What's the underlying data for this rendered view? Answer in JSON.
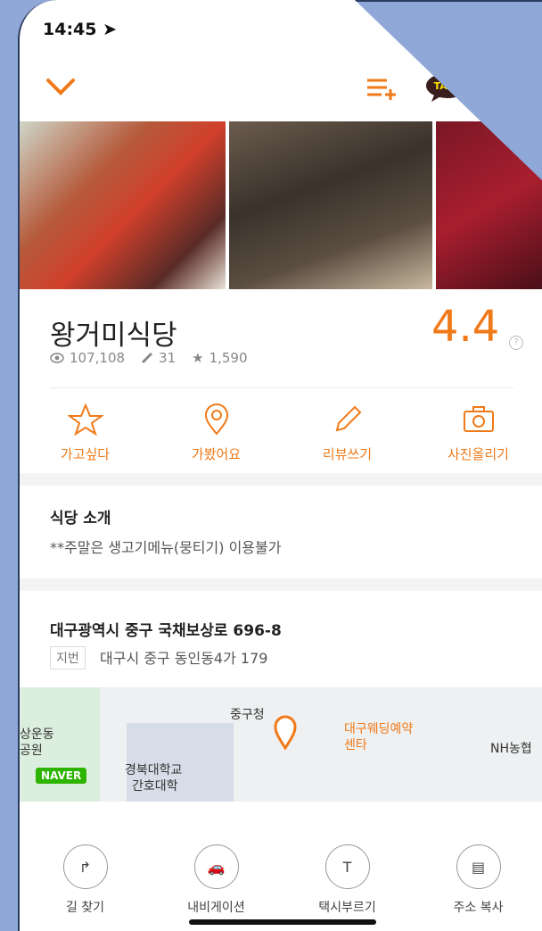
{
  "status_bar": {
    "time": "14:45 ➤"
  },
  "topbar": {
    "chevron_icon": "chevron-down-icon",
    "list_add_icon": "list-add-icon",
    "talk_badge": "TALK"
  },
  "restaurant": {
    "name": "왕거미식당",
    "views": "107,108",
    "reviews": "31",
    "stars": "1,590",
    "rating": "4.4"
  },
  "actions": [
    {
      "label": "가고싶다",
      "icon": "star-outline-icon"
    },
    {
      "label": "가봤어요",
      "icon": "location-pin-icon"
    },
    {
      "label": "리뷰쓰기",
      "icon": "pencil-icon"
    },
    {
      "label": "사진올리기",
      "icon": "camera-icon"
    }
  ],
  "intro": {
    "title": "식당 소개",
    "text": "**주말은 생고기메뉴(뭉티기) 이용불가"
  },
  "address": {
    "road": "대구광역시 중구 국채보상로 696-8",
    "jibun_badge": "지번",
    "jibun": "대구시 중구 동인동4가 179"
  },
  "map": {
    "labels": [
      "중구청",
      "대구웨딩예약",
      "센타",
      "상운동",
      "공원",
      "경북대학교",
      "간호대학",
      "NH농협",
      "NAVER"
    ]
  },
  "bottom_actions": [
    {
      "label": "길 찾기",
      "icon": "turn-arrow-icon"
    },
    {
      "label": "내비게이션",
      "icon": "car-icon"
    },
    {
      "label": "택시부르기",
      "icon": "taxi-icon"
    },
    {
      "label": "주소 복사",
      "icon": "copy-icon"
    }
  ],
  "colors": {
    "accent": "#f07a19",
    "text_primary": "#222222",
    "background": "#8fa8d8"
  }
}
